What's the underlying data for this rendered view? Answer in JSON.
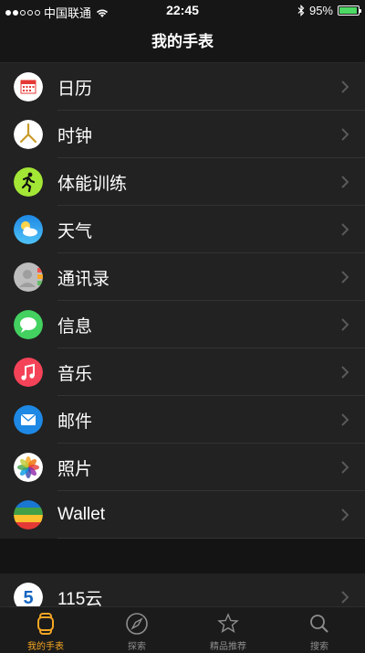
{
  "status_bar": {
    "carrier": "中国联通",
    "time": "22:45",
    "battery_percent": "95%",
    "battery_level": 0.95
  },
  "navbar": {
    "title": "我的手表"
  },
  "apps": [
    {
      "label": "日历",
      "icon": "calendar-icon"
    },
    {
      "label": "时钟",
      "icon": "clock-icon"
    },
    {
      "label": "体能训练",
      "icon": "workout-icon"
    },
    {
      "label": "天气",
      "icon": "weather-icon"
    },
    {
      "label": "通讯录",
      "icon": "contacts-icon"
    },
    {
      "label": "信息",
      "icon": "messages-icon"
    },
    {
      "label": "音乐",
      "icon": "music-icon"
    },
    {
      "label": "邮件",
      "icon": "mail-icon"
    },
    {
      "label": "照片",
      "icon": "photos-icon"
    },
    {
      "label": "Wallet",
      "icon": "wallet-icon"
    }
  ],
  "third_party": [
    {
      "label": "115云",
      "icon": "115-icon"
    }
  ],
  "tabs": [
    {
      "label": "我的手表",
      "icon": "watch-icon",
      "active": true
    },
    {
      "label": "探索",
      "icon": "compass-icon"
    },
    {
      "label": "精品推荐",
      "icon": "featured-icon"
    },
    {
      "label": "搜索",
      "icon": "search-icon"
    }
  ],
  "colors": {
    "accent": "#f5a623",
    "background": "#141414",
    "row": "#222222"
  }
}
